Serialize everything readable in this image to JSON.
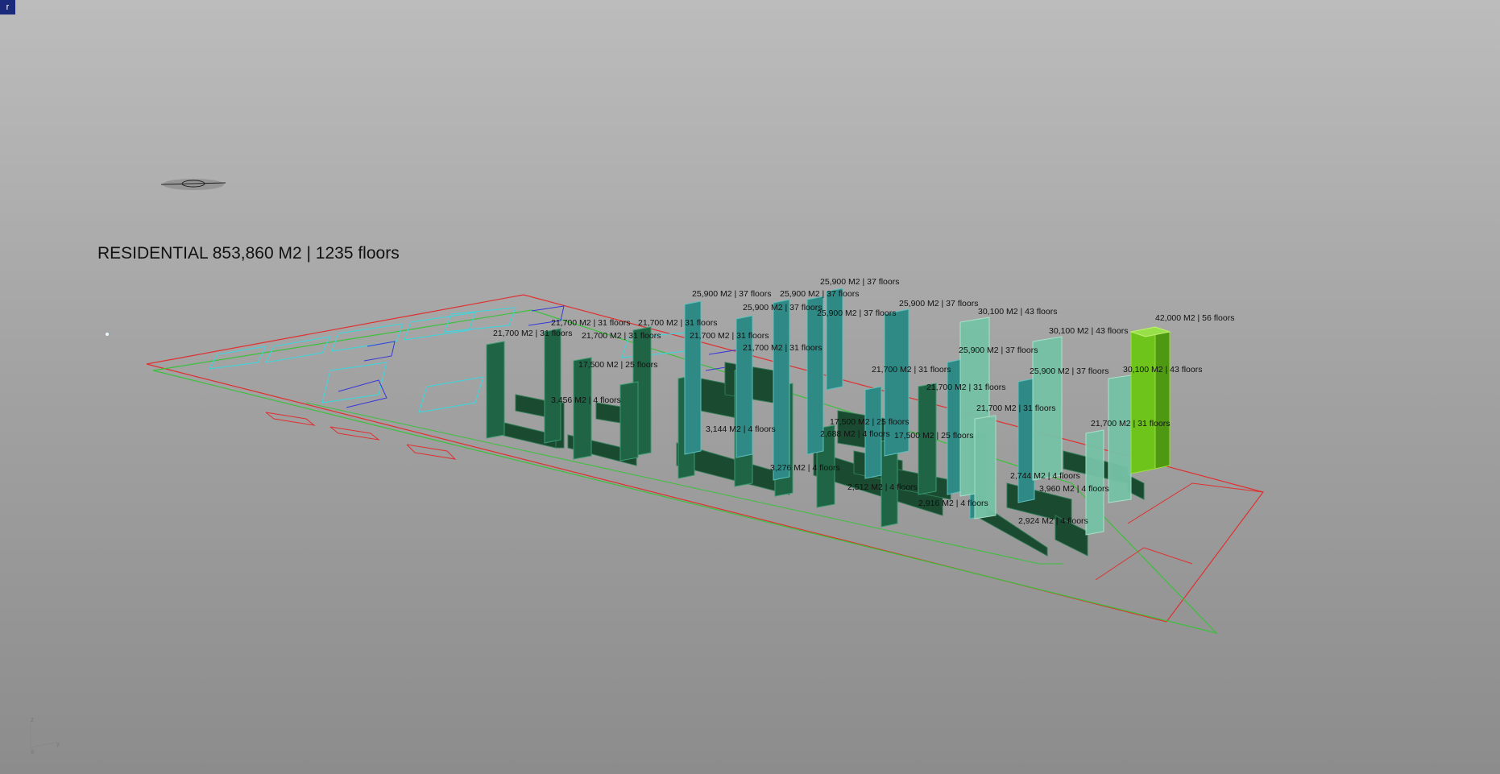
{
  "viewport": {
    "corner_tab_label": "r"
  },
  "summary": {
    "label": "RESIDENTIAL 853,860 M2 | 1235 floors"
  },
  "colors": {
    "site_boundary": "#e03030",
    "road_edge": "#3cc03c",
    "plot_outline": "#38d8e0",
    "footprint_outline": "#3838d8",
    "tower_dark": "#1c5c3c",
    "tower_teal": "#2f8a86",
    "tower_light": "#7cc7a8",
    "tower_highlight": "#7acc1c"
  },
  "building_labels": [
    "42,000 M2 | 56 floors",
    "30,100 M2 | 43 floors",
    "30,100 M2 | 43 floors",
    "30,100 M2 | 43 floors",
    "25,900 M2 | 37 floors",
    "25,900 M2 | 37 floors",
    "25,900 M2 | 37 floors",
    "25,900 M2 | 37 floors",
    "25,900 M2 | 37 floors",
    "25,900 M2 | 37 floors",
    "25,900 M2 | 37 floors",
    "25,900 M2 | 37 floors",
    "21,700 M2 | 31 floors",
    "21,700 M2 | 31 floors",
    "21,700 M2 | 31 floors",
    "21,700 M2 | 31 floors",
    "21,700 M2 | 31 floors",
    "21,700 M2 | 31 floors",
    "21,700 M2 | 31 floors",
    "21,700 M2 | 31 floors",
    "21,700 M2 | 31 floors",
    "21,700 M2 | 31 floors",
    "17,500 M2 | 25 floors",
    "17,500 M2 | 25 floors",
    "17,500 M2 | 25 floors",
    "2,924 M2 | 4 floors",
    "3,960 M2 | 4 floors",
    "2,744 M2 | 4 floors",
    "2,512 M2 | 4 floors",
    "3,276 M2 | 4 floors",
    "2,916 M2 | 4 floors",
    "3,456 M2 | 4 floors",
    "2,688 M2 | 4 floors",
    "3,144 M2 | 4 floors"
  ],
  "axis_indicator": {
    "z_label": "z",
    "y_label": "y",
    "x_label": "x"
  }
}
